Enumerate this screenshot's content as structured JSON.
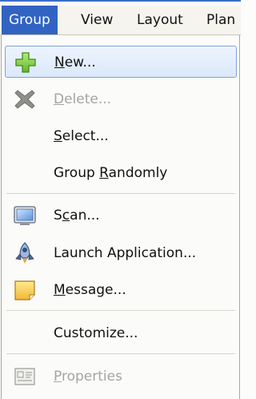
{
  "menubar": {
    "items": [
      {
        "label": "Group"
      },
      {
        "label": "View"
      },
      {
        "label": "Layout"
      },
      {
        "label": "Plan"
      }
    ]
  },
  "menu": {
    "items": [
      {
        "pre": "",
        "u": "N",
        "post": "ew...",
        "icon": "add-icon",
        "enabled": true,
        "highlighted": true
      },
      {
        "pre": "",
        "u": "D",
        "post": "elete...",
        "icon": "delete-icon",
        "enabled": false
      },
      {
        "pre": "",
        "u": "S",
        "post": "elect...",
        "icon": "",
        "enabled": true
      },
      {
        "pre": "Group ",
        "u": "R",
        "post": "andomly",
        "icon": "",
        "enabled": true
      },
      {
        "pre": "S",
        "u": "c",
        "post": "an...",
        "icon": "monitor-icon",
        "enabled": true
      },
      {
        "pre": "Launch Application...",
        "u": "",
        "post": "",
        "icon": "rocket-icon",
        "enabled": true
      },
      {
        "pre": "",
        "u": "M",
        "post": "essage...",
        "icon": "note-icon",
        "enabled": true
      },
      {
        "pre": "Customize...",
        "u": "",
        "post": "",
        "icon": "",
        "enabled": true
      },
      {
        "pre": "",
        "u": "P",
        "post": "roperties",
        "icon": "properties-icon",
        "enabled": false
      }
    ]
  },
  "colors": {
    "menubar_active": "#3163c2",
    "highlight_border": "#7ea2d8",
    "disabled_text": "#a4a4a0"
  }
}
